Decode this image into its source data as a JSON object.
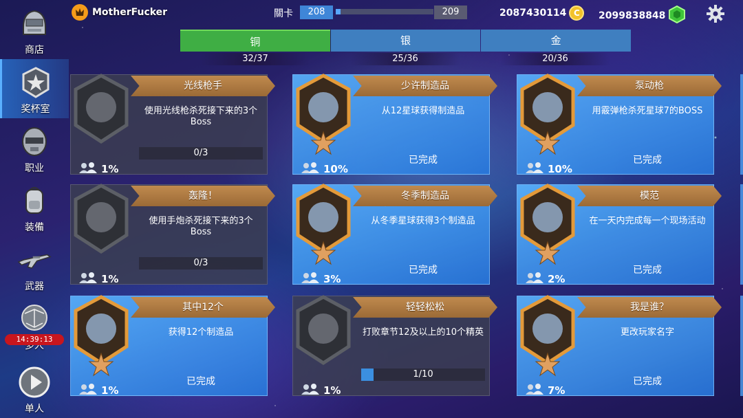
{
  "player": {
    "name": "MotherFucker"
  },
  "level": {
    "label": "關卡",
    "current": "208",
    "next": "209",
    "progress": 0.05
  },
  "currency": {
    "coins": "2087430114",
    "coin_symbol": "C",
    "gems": "2099838848"
  },
  "sidebar": {
    "items": [
      {
        "label": "商店"
      },
      {
        "label": "奖杯室"
      },
      {
        "label": "职业"
      },
      {
        "label": "装備"
      },
      {
        "label": "武器"
      },
      {
        "label": "多人",
        "timer": "14:39:13"
      },
      {
        "label": "单人"
      }
    ]
  },
  "tiers": [
    {
      "label": "铜",
      "count": "32/37"
    },
    {
      "label": "银",
      "count": "25/36"
    },
    {
      "label": "金",
      "count": "20/36"
    }
  ],
  "cards": [
    {
      "title": "光线枪手",
      "desc": "使用光线枪杀死接下来的3个Boss",
      "progress_text": "0/3",
      "progress": 0,
      "percent": "1%",
      "state": "locked",
      "icon": "ray-gun-icon"
    },
    {
      "title": "少许制造品",
      "desc": "从12星球获得制造品",
      "status": "已完成",
      "percent": "10%",
      "state": "done",
      "icon": "planet-crate-icon"
    },
    {
      "title": "泵动枪",
      "desc": "用霰弹枪杀死星球7的BOSS",
      "status": "已完成",
      "percent": "10%",
      "state": "done",
      "icon": "pump-gun-icon"
    },
    {
      "title": "轰隆！",
      "desc": "使用手炮杀死接下来的3个Boss",
      "progress_text": "0/3",
      "progress": 0,
      "percent": "1%",
      "state": "locked",
      "icon": "hand-cannon-icon"
    },
    {
      "title": "冬季制造品",
      "desc": "从冬季星球获得3个制造品",
      "status": "已完成",
      "percent": "3%",
      "state": "done",
      "icon": "winter-crate-icon"
    },
    {
      "title": "模范",
      "desc": "在一天内完成每一个现场活动",
      "status": "已完成",
      "percent": "2%",
      "state": "done",
      "icon": "globe-icon"
    },
    {
      "title": "其中12个",
      "desc": "获得12个制造品",
      "status": "已完成",
      "percent": "1%",
      "state": "done",
      "icon": "crate-stack-icon"
    },
    {
      "title": "轻轻松松",
      "desc": "打败章节12及以上的10个精英",
      "progress_text": "1/10",
      "progress": 0.1,
      "percent": "1%",
      "state": "locked",
      "icon": "skull-icon"
    },
    {
      "title": "我是谁？",
      "desc": "更改玩家名字",
      "status": "已完成",
      "percent": "7%",
      "state": "done",
      "icon": "robot-head-icon"
    }
  ]
}
